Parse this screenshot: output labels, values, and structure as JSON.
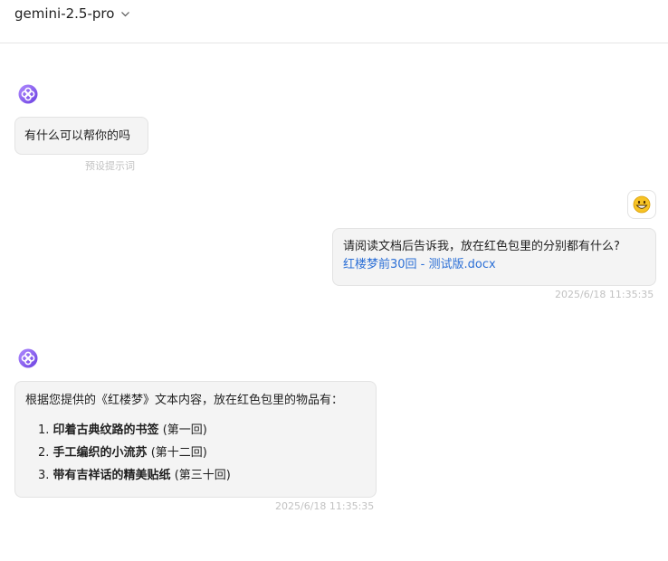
{
  "header": {
    "model_name": "gemini-2.5-pro"
  },
  "messages": {
    "greeting": {
      "text": "有什么可以帮你的吗",
      "caption": "预设提示词"
    },
    "user": {
      "text": "请阅读文档后告诉我，放在红色包里的分别都有什么?",
      "attachment": "红楼梦前30回 - 测试版.docx",
      "timestamp": "2025/6/18 11:35:35",
      "avatar_icon": "grinning-face-icon"
    },
    "answer": {
      "intro": "根据您提供的《红楼梦》文本内容，放在红色包里的物品有：",
      "items": [
        {
          "number": "1.",
          "item": "印着古典纹路的书签",
          "chapter": "(第一回)"
        },
        {
          "number": "2.",
          "item": "手工编织的小流苏",
          "chapter": "(第十二回)"
        },
        {
          "number": "3.",
          "item": "带有吉祥话的精美贴纸",
          "chapter": "(第三十回)"
        }
      ],
      "timestamp": "2025/6/18 11:35:35"
    }
  },
  "colors": {
    "link": "#2b6fd6",
    "bubble_bg": "#f4f4f4",
    "meta_text": "#c2c2c2",
    "assistant_avatar": "#8a5cf6"
  }
}
